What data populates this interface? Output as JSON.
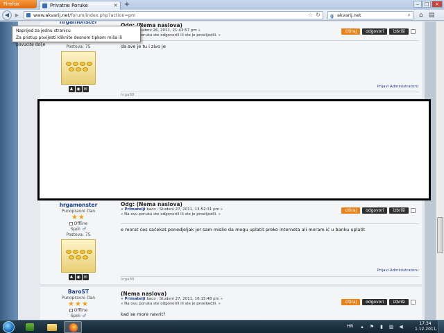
{
  "browser": {
    "app_button_label": "Firefox",
    "tab_title": "Privatne Poruke",
    "new_tab_glyph": "+",
    "url_host": "www.akvarij.net",
    "url_path": "/forum/index.php?action=pm",
    "search_text": "akvarij.net"
  },
  "tooltip": {
    "line1": "Naprijed za jednu stranicu",
    "line2": "Za pristup povijesti kliknite desnom tipkom miša ili povucite dolje"
  },
  "posts": [
    {
      "author": "hrgamonster",
      "spol_label": "Spol:",
      "postova": "Postova: 75",
      "title": "Odg: (Nema naslova)",
      "meta_line1": "« baco : Studeni 26, 2011, 21:43:57 pm »",
      "meta_line2": "« Na ovu poruku ste odgovorili ili ste je proslijedili. »",
      "body": "da sve je tu i zivo je",
      "report": "Prijavi Administratoru",
      "signature": "hrga88"
    },
    {
      "author": "hrgamonster",
      "rank": "Punopravni član",
      "stars": "★★",
      "online": "Offline",
      "spol_label": "Spol:",
      "postova": "Postova: 75",
      "title": "Odg: (Nema naslova)",
      "meta_line1_prefix": "« Primatelji",
      "meta_line1": "baco : Studeni 27, 2011, 13:52:31 pm »",
      "meta_line2": "« Na ovu poruku ste odgovorili ili ste je proslijedili. »",
      "body": "e morat ćes saćekat ponedjeljak jer sam mislio da mogu uplatit preko interneta ali moram ić u banku uplatit",
      "report": "Prijavi Administratoru",
      "signature": "hrga88"
    },
    {
      "author": "BaroST",
      "rank": "Punopravni član",
      "stars": "★★★",
      "online": "Offline",
      "spol_label": "Spol:",
      "title": "(Nema naslova)",
      "meta_line1_prefix": "« Primatelji",
      "meta_line1": "baco : Studeni 27, 2011, 16:15:48 pm »",
      "meta_line2": "« Na ovu poruku ste odgovorili ili ste je proslijedili. »",
      "body": "kad se more navrit?"
    }
  ],
  "actions": {
    "cite": "citiraj",
    "reply": "odgovori",
    "delete": "izbriši"
  },
  "taskbar": {
    "language": "HR",
    "time": "17:34",
    "date": "1.12.2011."
  },
  "colors": {
    "cite_button": "#e8831a",
    "dark_button": "#2f2f2f",
    "username": "#1d3f8a",
    "star": "#e8a119"
  }
}
